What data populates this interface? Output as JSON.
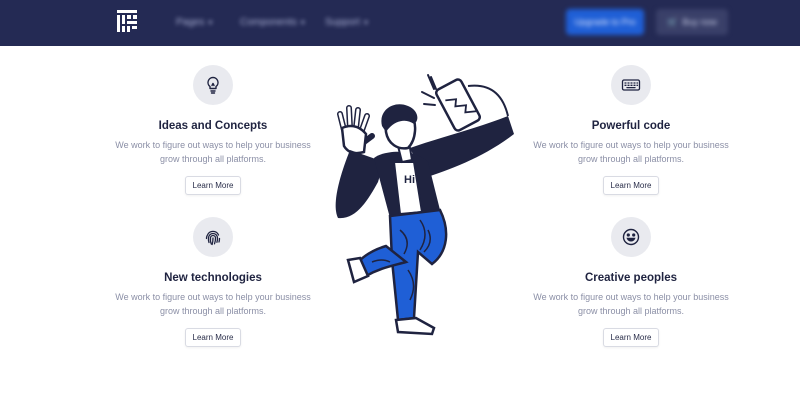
{
  "navbar": {
    "menu": [
      {
        "label": "Pages"
      },
      {
        "label": "Components"
      },
      {
        "label": "Support"
      }
    ],
    "primary_button": "Upgrade to Pro",
    "secondary_button": "Buy now"
  },
  "features": [
    {
      "icon": "lightbulb-icon",
      "title": "Ideas and Concepts",
      "desc_line1": "We work to figure out ways to help your business",
      "desc_line2": "grow through all platforms.",
      "button": "Learn More"
    },
    {
      "icon": "fingerprint-icon",
      "title": "New technologies",
      "desc_line1": "We work to figure out ways to help your business",
      "desc_line2": "grow through all platforms.",
      "button": "Learn More"
    },
    {
      "icon": "keyboard-icon",
      "title": "Powerful code",
      "desc_line1": "We work to figure out ways to help your business",
      "desc_line2": "grow through all platforms.",
      "button": "Learn More"
    },
    {
      "icon": "smiley-icon",
      "title": "Creative peoples",
      "desc_line1": "We work to figure out ways to help your business",
      "desc_line2": "grow through all platforms.",
      "button": "Learn More"
    }
  ],
  "illustration": {
    "shirt_text": "Hi"
  },
  "colors": {
    "navbar_bg": "#242a54",
    "primary_button": "#1f5fd6",
    "ink": "#1f2340",
    "accent_blue": "#1f5fd6",
    "icon_circle": "#e9eaef"
  }
}
